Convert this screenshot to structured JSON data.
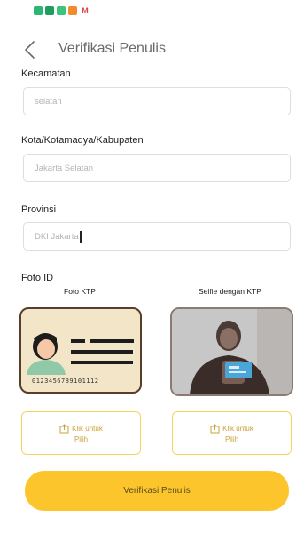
{
  "status_bar": {
    "icons": [
      {
        "name": "app-icon-green-1",
        "color": "#2bb673"
      },
      {
        "name": "app-icon-green-2",
        "color": "#1f9d5f"
      },
      {
        "name": "app-icon-green-3",
        "color": "#3cc47c"
      },
      {
        "name": "app-icon-orange",
        "color": "#f28b30"
      }
    ],
    "mail_glyph": "M"
  },
  "header": {
    "title": "Verifikasi Penulis"
  },
  "form": {
    "kecamatan": {
      "label": "Kecamatan",
      "value": "selatan"
    },
    "kota": {
      "label": "Kota/Kotamadya/Kabupaten",
      "placeholder": "Jakarta Selatan"
    },
    "provinsi": {
      "label": "Provinsi",
      "value": "DKI Jakarta"
    }
  },
  "foto_id": {
    "label": "Foto ID",
    "ktp_caption": "Foto KTP",
    "selfie_caption": "Selfie dengan KTP",
    "ktp_number": "0123456789101112",
    "upload_left": {
      "line1": "Klik untuk",
      "line2": "Pilih"
    },
    "upload_right": {
      "line1": "Klik untuk",
      "line2": "Pilih"
    }
  },
  "submit": {
    "label": "Verifikasi Penulis"
  },
  "colors": {
    "accent": "#fbc52b",
    "accent_text": "#c9a43a"
  }
}
